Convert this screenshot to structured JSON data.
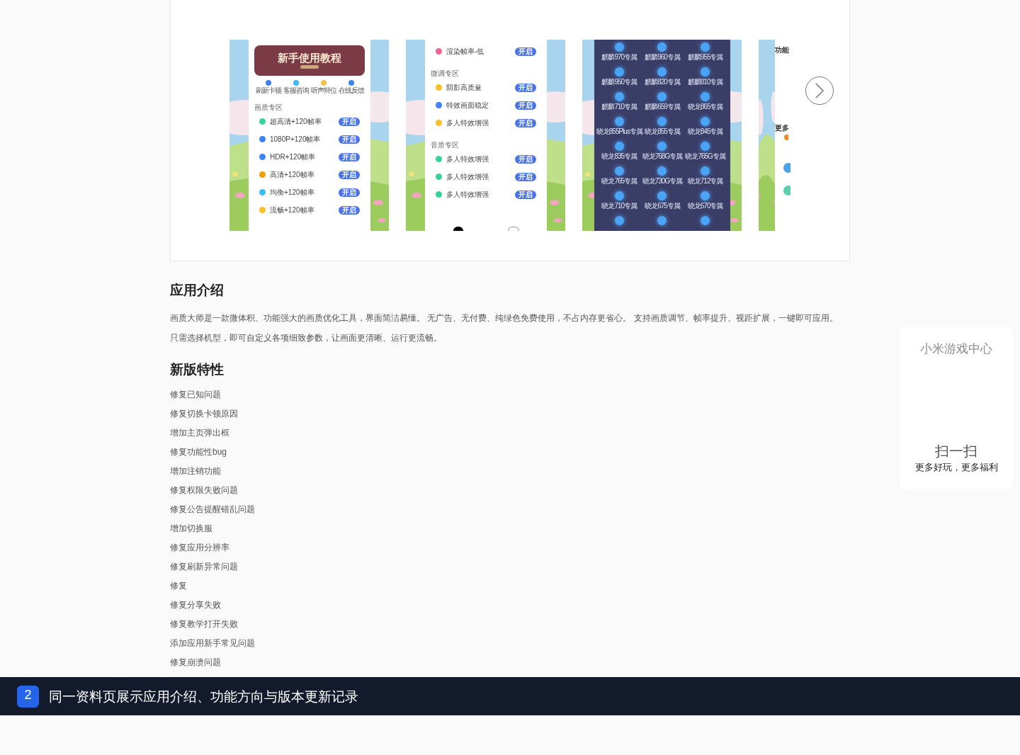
{
  "gallery": {
    "screens": [
      {
        "kind": "tutorial",
        "banner_title": "新手使用教程",
        "shortcuts": [
          {
            "label": "刷新卡顿",
            "color": "#3b82f6"
          },
          {
            "label": "客服咨询",
            "color": "#38bdf8"
          },
          {
            "label": "听声辩位",
            "color": "#f5c04a"
          },
          {
            "label": "在线反馈",
            "color": "#3b82f6"
          }
        ],
        "sections": [
          {
            "title": "画质专区",
            "rows": [
              {
                "label": "超高清+120帧率",
                "color": "#34d399",
                "button": "开启"
              },
              {
                "label": "1080P+120帧率",
                "color": "#3b82f6",
                "button": "开启"
              },
              {
                "label": "HDR+120帧率",
                "color": "#3b82f6",
                "button": "开启"
              },
              {
                "label": "高清+120帧率",
                "color": "#f59e0b",
                "button": "开启"
              },
              {
                "label": "均衡+120帧率",
                "color": "#38bdf8",
                "button": "开启"
              },
              {
                "label": "流畅+120帧率",
                "color": "#fbbf24",
                "button": "开启"
              }
            ]
          }
        ]
      },
      {
        "kind": "settings",
        "sections": [
          {
            "rows": [
              {
                "label": "渲染帧率-低",
                "color": "#f06292",
                "button": "开启"
              }
            ]
          },
          {
            "title": "微调专区",
            "rows": [
              {
                "label": "阴影高质量",
                "color": "#fbbf24",
                "button": "开启"
              },
              {
                "label": "特效画面稳定",
                "color": "#3b82f6",
                "button": "开启"
              },
              {
                "label": "多人特效增强",
                "color": "#fbbf24",
                "button": "开启"
              }
            ]
          },
          {
            "title": "音质专区",
            "rows": [
              {
                "label": "多人特效增强",
                "color": "#34d399",
                "button": "开启"
              },
              {
                "label": "多人特效增强",
                "color": "#34d399",
                "button": "开启"
              },
              {
                "label": "多人特效增强",
                "color": "#34d399",
                "button": "开启"
              }
            ]
          }
        ]
      },
      {
        "kind": "devices",
        "devices": [
          "麒麟970专属",
          "麒麟960专属",
          "麒麟955专属",
          "麒麟950专属",
          "麒麟820专属",
          "麒麟810专属",
          "麒麟710专属",
          "麒麟659专属",
          "晓龙865专属",
          "晓龙855Plus专属",
          "晓龙855专属",
          "晓龙845专属",
          "晓龙835专属",
          "晓龙768G专属",
          "晓龙765G专属",
          "晓龙765专属",
          "晓龙730G专属",
          "晓龙712专属",
          "晓龙710专属",
          "晓龙675专属",
          "晓龙670专属"
        ]
      },
      {
        "kind": "partial",
        "labels": [
          "功能",
          "更多"
        ]
      }
    ]
  },
  "intro": {
    "title": "应用介绍",
    "text": "画质大师是一款微体积、功能强大的画质优化工具，界面简洁易懂。 无广告、无付费、纯绿色免费使用，不占内存更省心。 支持画质调节、帧率提升、视距扩展，一键即可应用。只需选择机型，即可自定义各项细致参数，让画面更清晰、运行更流畅。"
  },
  "changelog": {
    "title": "新版特性",
    "items": [
      "修复已知问题",
      "修复切换卡顿原因",
      "增加主页弹出框",
      "修复功能性bug",
      "增加注销功能",
      "修复权限失败问题",
      "修复公告提醒错乱问题",
      "增加切换服",
      "修复应用分辨率",
      "修复刷新异常问题",
      "修复",
      "修复分享失败",
      "修复教学打开失败",
      "添加应用新手常见问题",
      "修复崩溃问题"
    ]
  },
  "qr_panel": {
    "title": "小米游戏中心",
    "scan": "扫一扫",
    "tagline": "更多好玩，更多福利"
  },
  "caption": {
    "number": "2",
    "text": "同一资料页展示应用介绍、功能方向与版本更新记录"
  }
}
